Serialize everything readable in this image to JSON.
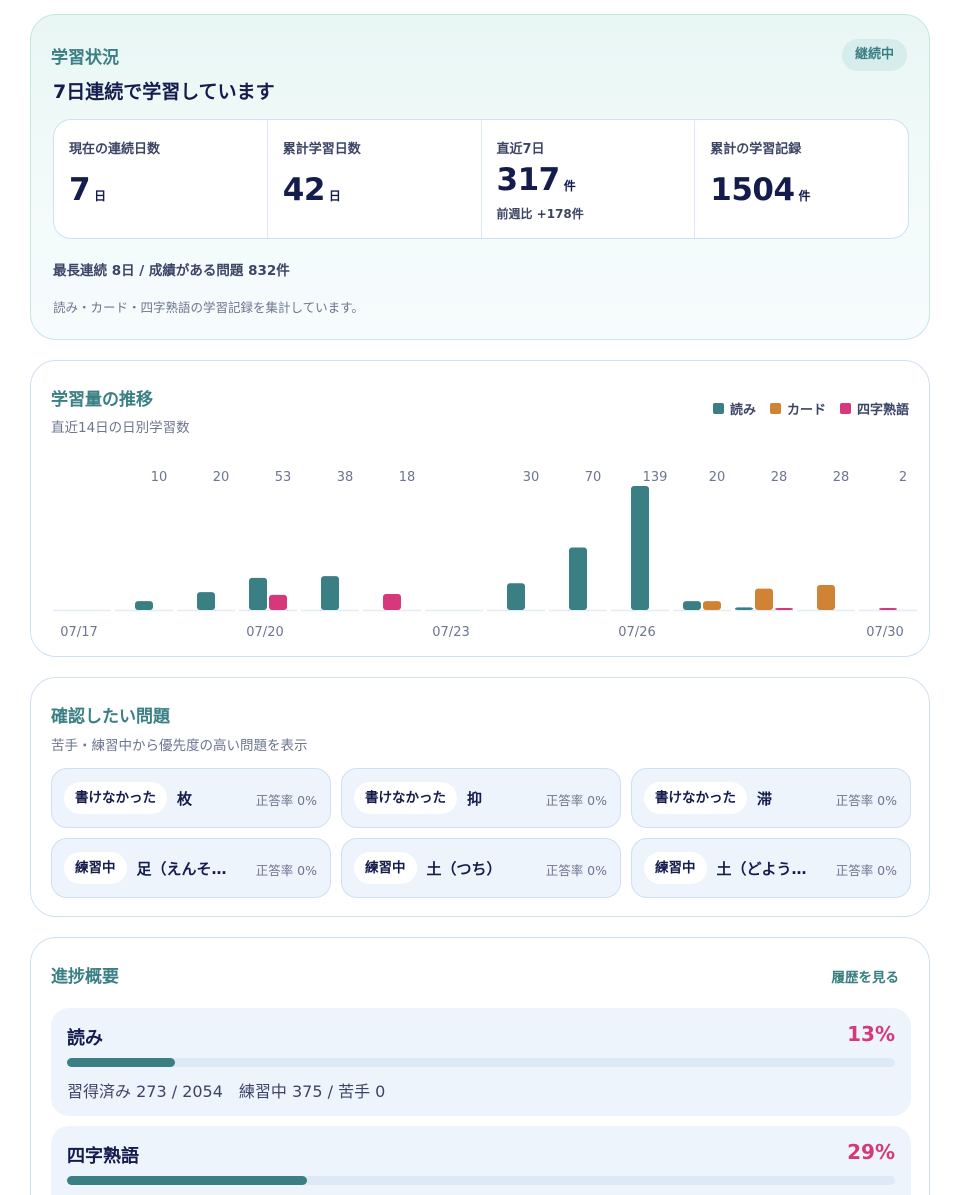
{
  "status": {
    "title": "学習状況",
    "headline": "7日連続で学習しています",
    "badge": "継続中",
    "stats": [
      {
        "label": "現在の連続日数",
        "value": "7",
        "unit": "日",
        "note": ""
      },
      {
        "label": "累計学習日数",
        "value": "42",
        "unit": "日",
        "note": ""
      },
      {
        "label": "直近7日",
        "value": "317",
        "unit": "件",
        "note": "前週比 +178件"
      },
      {
        "label": "累計の学習記録",
        "value": "1504",
        "unit": "件",
        "note": ""
      }
    ],
    "summary": "最長連続 8日 / 成績がある問題 832件",
    "footnote": "読み・カード・四字熟語の学習記録を集計しています。"
  },
  "trend": {
    "title": "学習量の推移",
    "subtitle": "直近14日の日別学習数",
    "legend": [
      {
        "label": "読み",
        "color": "#3a7f84"
      },
      {
        "label": "カード",
        "color": "#d08335"
      },
      {
        "label": "四字熟語",
        "color": "#d6397b"
      }
    ]
  },
  "chart_data": {
    "type": "bar",
    "stacked": false,
    "categories": [
      "07/17",
      "07/18",
      "07/19",
      "07/20",
      "07/21",
      "07/22",
      "07/23",
      "07/24",
      "07/25",
      "07/26",
      "07/27",
      "07/28",
      "07/29",
      "07/30"
    ],
    "tick_labels": [
      "07/17",
      "",
      "",
      "07/20",
      "",
      "",
      "07/23",
      "",
      "",
      "07/26",
      "",
      "",
      "",
      "07/30"
    ],
    "totals": [
      "",
      "10",
      "20",
      "53",
      "38",
      "18",
      "",
      "30",
      "70",
      "139",
      "20",
      "28",
      "28",
      "2"
    ],
    "series": [
      {
        "name": "読み",
        "color": "#3a7f84",
        "values": [
          0,
          10,
          20,
          36,
          38,
          0,
          0,
          30,
          70,
          139,
          10,
          3,
          0,
          0
        ]
      },
      {
        "name": "カード",
        "color": "#d08335",
        "values": [
          0,
          0,
          0,
          0,
          0,
          0,
          0,
          0,
          0,
          0,
          10,
          24,
          28,
          0
        ]
      },
      {
        "name": "四字熟語",
        "color": "#d6397b",
        "values": [
          0,
          0,
          0,
          17,
          0,
          18,
          0,
          0,
          0,
          0,
          0,
          1,
          0,
          2
        ]
      }
    ],
    "ylim": [
      0,
      139
    ]
  },
  "review": {
    "title": "確認したい問題",
    "subtitle": "苦手・練習中から優先度の高い問題を表示",
    "items": [
      {
        "tag": "書けなかった",
        "word": "枚",
        "rate": "正答率 0%"
      },
      {
        "tag": "書けなかった",
        "word": "抑",
        "rate": "正答率 0%"
      },
      {
        "tag": "書けなかった",
        "word": "滞",
        "rate": "正答率 0%"
      },
      {
        "tag": "練習中",
        "word": "足（えんそ…",
        "rate": "正答率 0%"
      },
      {
        "tag": "練習中",
        "word": "土（つち）",
        "rate": "正答率 0%"
      },
      {
        "tag": "練習中",
        "word": "土（どよう…",
        "rate": "正答率 0%"
      }
    ]
  },
  "progress": {
    "title": "進捗概要",
    "history_link": "履歴を見る",
    "rows": [
      {
        "title": "読み",
        "percent": "13%",
        "fraction": 0.13,
        "detail": "習得済み 273 / 2054　練習中 375 / 苦手 0"
      },
      {
        "title": "四字熟語",
        "percent": "29%",
        "fraction": 0.29,
        "detail": ""
      }
    ]
  }
}
